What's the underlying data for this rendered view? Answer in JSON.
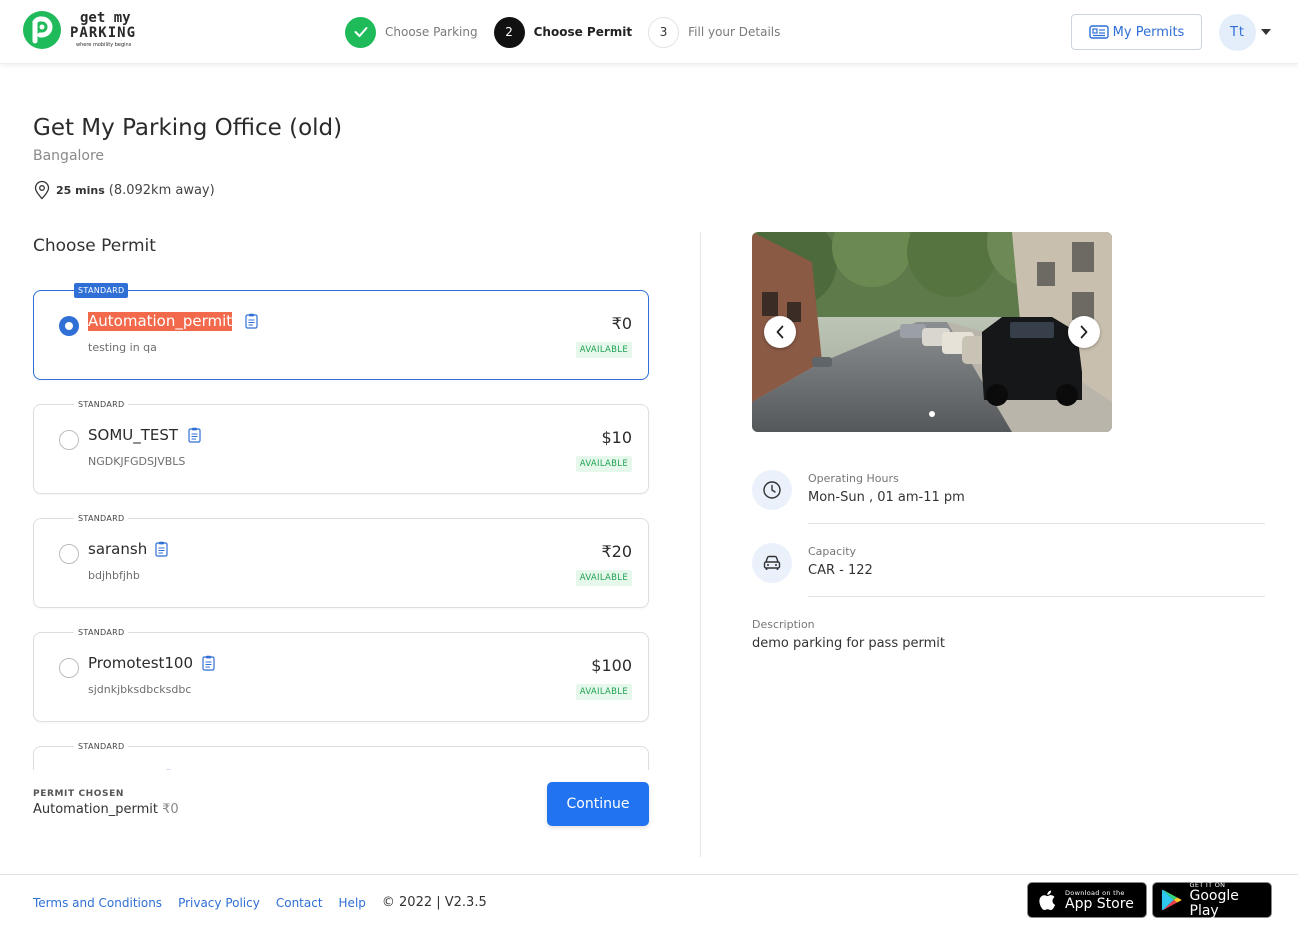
{
  "brand": {
    "name_line1": "get my",
    "name_line2": "PARKING",
    "tagline": "where mobility begins",
    "color": "#1fba5a"
  },
  "stepper": [
    {
      "number": "1",
      "label": "Choose Parking",
      "state": "done"
    },
    {
      "number": "2",
      "label": "Choose Permit",
      "state": "active"
    },
    {
      "number": "3",
      "label": "Fill your Details",
      "state": "pending"
    }
  ],
  "header": {
    "my_permits_label": "My Permits",
    "avatar_initials": "Tt"
  },
  "parking": {
    "title": "Get My Parking Office (old)",
    "city": "Bangalore",
    "travel_time": "25 mins",
    "distance": "(8.092km away)"
  },
  "permits": {
    "heading": "Choose Permit",
    "items": [
      {
        "tier": "STANDARD",
        "name": "Automation_permit",
        "description": "testing in qa",
        "price": "₹0",
        "status": "AVAILABLE",
        "selected": true
      },
      {
        "tier": "STANDARD",
        "name": "SOMU_TEST",
        "description": "NGDKJFGDSJVBLS",
        "price": "$10",
        "status": "AVAILABLE",
        "selected": false
      },
      {
        "tier": "STANDARD",
        "name": "saransh",
        "description": "bdjhbfjhb",
        "price": "₹20",
        "status": "AVAILABLE",
        "selected": false
      },
      {
        "tier": "STANDARD",
        "name": "Promotest100",
        "description": "sjdnkjbksdbcksdbc",
        "price": "$100",
        "status": "AVAILABLE",
        "selected": false
      },
      {
        "tier": "STANDARD",
        "name": "",
        "description": "",
        "price": "",
        "status": "",
        "selected": false
      }
    ]
  },
  "selection": {
    "label": "PERMIT CHOSEN",
    "name": "Automation_permit",
    "price": "₹0",
    "continue_label": "Continue"
  },
  "details": {
    "operating_hours_label": "Operating Hours",
    "operating_hours_value": "Mon-Sun , 01 am-11 pm",
    "capacity_label": "Capacity",
    "capacity_value": "CAR - 122",
    "description_label": "Description",
    "description_value": "demo parking for pass permit"
  },
  "carousel": {
    "prev_icon": "chevron-left-icon",
    "next_icon": "chevron-right-icon",
    "slide_count": 1,
    "active_slide": 1
  },
  "footer": {
    "links": [
      "Terms and Conditions",
      "Privacy Policy",
      "Contact",
      "Help"
    ],
    "copyright": "© 2022 | V2.3.5",
    "app_store_small": "Download on the",
    "app_store_big": "App Store",
    "play_store_small": "GET IT ON",
    "play_store_big": "Google Play"
  },
  "colors": {
    "accent": "#2f6fd6",
    "primary_button": "#2173f0",
    "success": "#1fba5a",
    "highlight": "#f26a4b"
  }
}
